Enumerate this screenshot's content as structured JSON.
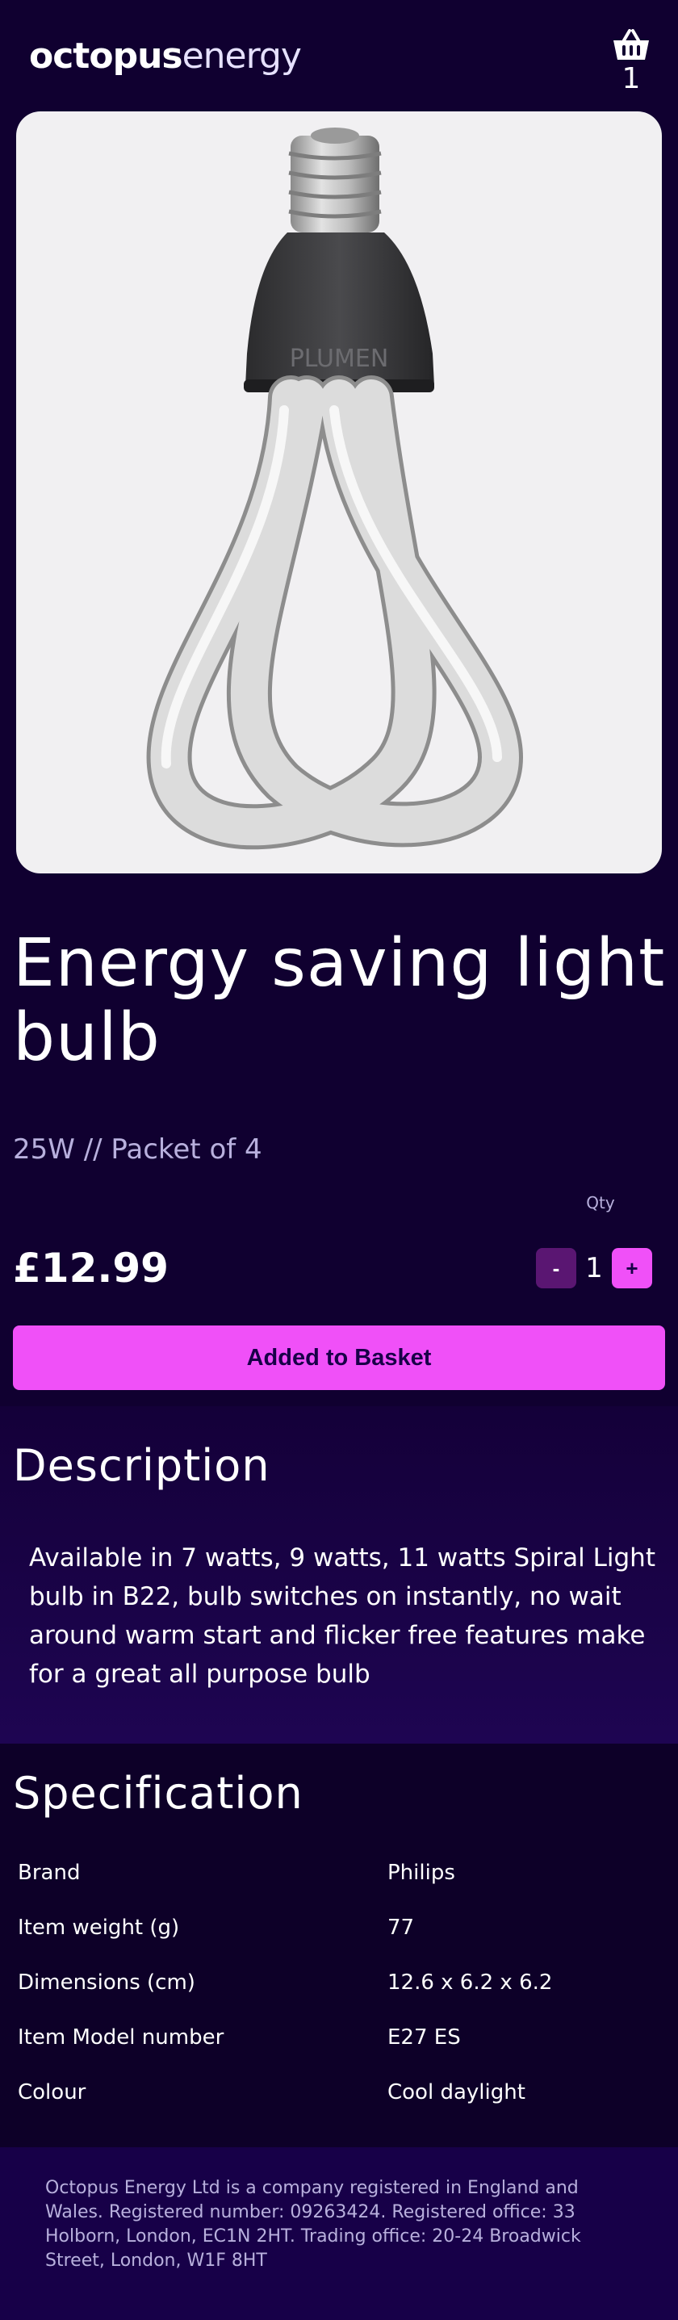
{
  "header": {
    "logo_bold": "octopus",
    "logo_light": "energy",
    "basket_count": "1"
  },
  "product": {
    "title": "Energy saving light bulb",
    "subtitle": "25W // Packet of 4",
    "price": "£12.99",
    "qty_label": "Qty",
    "qty_minus": "-",
    "qty_value": "1",
    "qty_plus": "+",
    "add_button": "Added to Basket",
    "image_brand_text": "PLUMEN"
  },
  "description": {
    "heading": "Description",
    "text": "Available in 7 watts, 9 watts, 11 watts Spiral Light bulb in B22, bulb switches on instantly, no wait around warm start and flicker free features make for a great all purpose bulb"
  },
  "specification": {
    "heading": "Specification",
    "rows": [
      {
        "key": "Brand",
        "value": "Philips"
      },
      {
        "key": "Item weight (g)",
        "value": "77"
      },
      {
        "key": "Dimensions (cm)",
        "value": "12.6 x 6.2 x 6.2"
      },
      {
        "key": "Item Model number",
        "value": "E27 ES"
      },
      {
        "key": "Colour",
        "value": "Cool daylight"
      }
    ]
  },
  "footer": {
    "text": "Octopus Energy Ltd is a company registered in England and Wales. Registered number: 09263424. Registered office: 33 Holborn, London, EC1N 2HT. Trading office: 20-24 Broadwick Street, London, W1F 8HT"
  },
  "colors": {
    "background": "#100030",
    "accent_pink": "#f050f8",
    "minus_button": "#5a1672",
    "muted_text": "#b8b0dd",
    "footer_bg": "#170048"
  },
  "icons": {
    "basket": "basket-icon",
    "product": "light-bulb-image"
  }
}
